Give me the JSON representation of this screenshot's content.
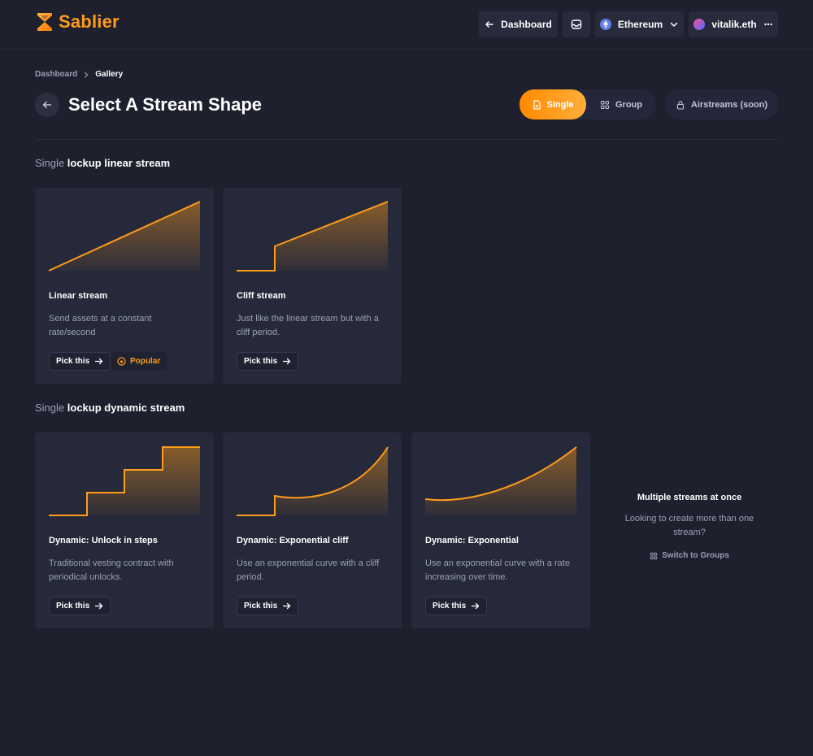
{
  "header": {
    "logo_text": "Sablier",
    "dashboard_label": "Dashboard",
    "network_label": "Ethereum",
    "account_label": "vitalik.eth"
  },
  "breadcrumb": {
    "parent": "Dashboard",
    "current": "Gallery"
  },
  "page": {
    "title": "Select A Stream Shape"
  },
  "toggle": {
    "single_label": "Single",
    "group_label": "Group",
    "airstreams_label": "Airstreams (soon)"
  },
  "colors": {
    "accent": "#ff9c1a",
    "background": "#1e202e",
    "card": "#262939"
  },
  "sections": [
    {
      "prefix": "Single",
      "title": "lockup linear stream"
    },
    {
      "prefix": "Single",
      "title": "lockup dynamic stream"
    }
  ],
  "cards": [
    {
      "title": "Linear stream",
      "description": "Send assets at a constant rate/second",
      "button": "Pick this",
      "badge": "Popular",
      "icon": "linear-shape"
    },
    {
      "title": "Cliff stream",
      "description": "Just like the linear stream but with a cliff period.",
      "button": "Pick this",
      "icon": "cliff-shape"
    },
    {
      "title": "Dynamic: Unlock in steps",
      "description": "Traditional vesting contract with periodical unlocks.",
      "button": "Pick this",
      "icon": "steps-shape"
    },
    {
      "title": "Dynamic: Exponential cliff",
      "description": "Use an exponential curve with a cliff period.",
      "button": "Pick this",
      "icon": "exponential-cliff-shape"
    },
    {
      "title": "Dynamic: Exponential",
      "description": "Use an exponential curve with a rate increasing over time.",
      "button": "Pick this",
      "icon": "exponential-shape"
    }
  ],
  "multi": {
    "title": "Multiple streams at once",
    "description": "Looking to create more than one stream?",
    "link": "Switch to Groups"
  }
}
